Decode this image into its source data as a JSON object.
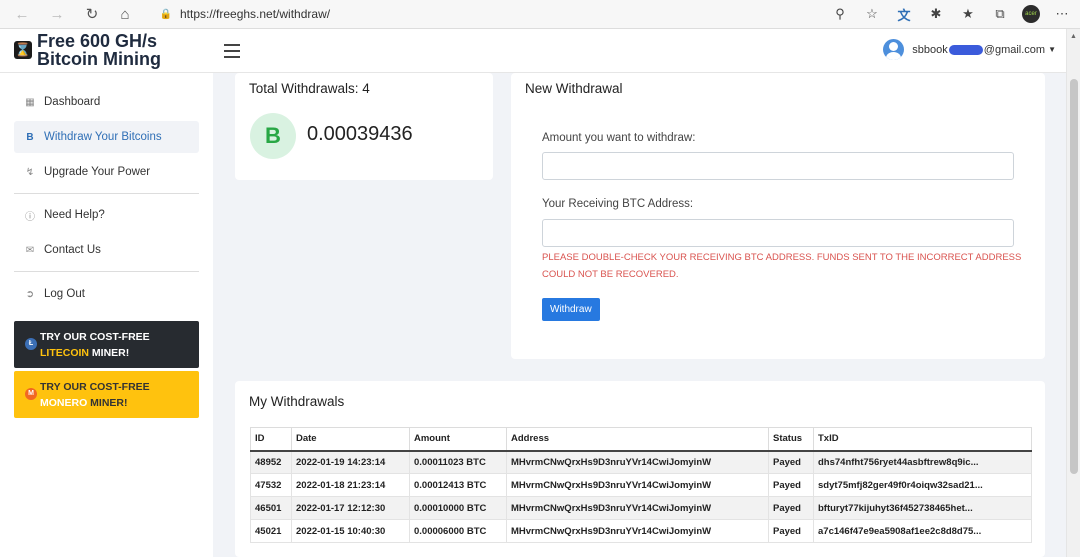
{
  "browser": {
    "url": "https://freeghs.net/withdraw/",
    "profile_label": "acer"
  },
  "header": {
    "brand_line1": "Free 600 GH/s",
    "brand_line2": "Bitcoin Mining",
    "user_email_prefix": "sbbook",
    "user_email_suffix": "@gmail.com"
  },
  "sidebar": {
    "items": [
      {
        "label": "Dashboard",
        "icon": "grid-icon"
      },
      {
        "label": "Withdraw Your Bitcoins",
        "icon": "bitcoin-icon"
      },
      {
        "label": "Upgrade Your Power",
        "icon": "bolt-icon"
      },
      {
        "label": "Need Help?",
        "icon": "help-icon"
      },
      {
        "label": "Contact Us",
        "icon": "mail-icon"
      },
      {
        "label": "Log Out",
        "icon": "logout-icon"
      }
    ],
    "promo_litecoin": {
      "line1": "TRY OUR COST-FREE",
      "highlight": "LITECOIN",
      "rest": " MINER!"
    },
    "promo_monero": {
      "line1": "TRY OUR COST-FREE",
      "highlight": "MONERO",
      "rest": " MINER!"
    }
  },
  "total_card": {
    "title": "Total Withdrawals: 4",
    "amount": "0.00039436",
    "symbol": "B"
  },
  "new_withdrawal": {
    "title": "New Withdrawal",
    "amount_label": "Amount you want to withdraw:",
    "amount_value": "",
    "address_label": "Your Receiving BTC Address:",
    "address_value": "",
    "warning": "PLEASE DOUBLE-CHECK YOUR RECEIVING BTC ADDRESS. FUNDS SENT TO THE INCORRECT ADDRESS COULD NOT BE RECOVERED.",
    "button": "Withdraw"
  },
  "my_withdrawals": {
    "title": "My Withdrawals",
    "columns": [
      "ID",
      "Date",
      "Amount",
      "Address",
      "Status",
      "TxID"
    ],
    "rows": [
      [
        "48952",
        "2022-01-19 14:23:14",
        "0.00011023 BTC",
        "MHvrmCNwQrxHs9D3nruYVr14CwiJomyinW",
        "Payed",
        "dhs74nfht756ryet44asbftrew8q9ic..."
      ],
      [
        "47532",
        "2022-01-18 21:23:14",
        "0.00012413 BTC",
        "MHvrmCNwQrxHs9D3nruYVr14CwiJomyinW",
        "Payed",
        "sdyt75mfj82ger49f0r4oiqw32sad21..."
      ],
      [
        "46501",
        "2022-01-17 12:12:30",
        "0.00010000 BTC",
        "MHvrmCNwQrxHs9D3nruYVr14CwiJomyinW",
        "Payed",
        "bfturyt77kijuhyt36f452738465het..."
      ],
      [
        "45021",
        "2022-01-15 10:40:30",
        "0.00006000 BTC",
        "MHvrmCNwQrxHs9D3nruYVr14CwiJomyinW",
        "Payed",
        "a7c146f47e9ea5908af1ee2c8d8d75..."
      ]
    ]
  }
}
